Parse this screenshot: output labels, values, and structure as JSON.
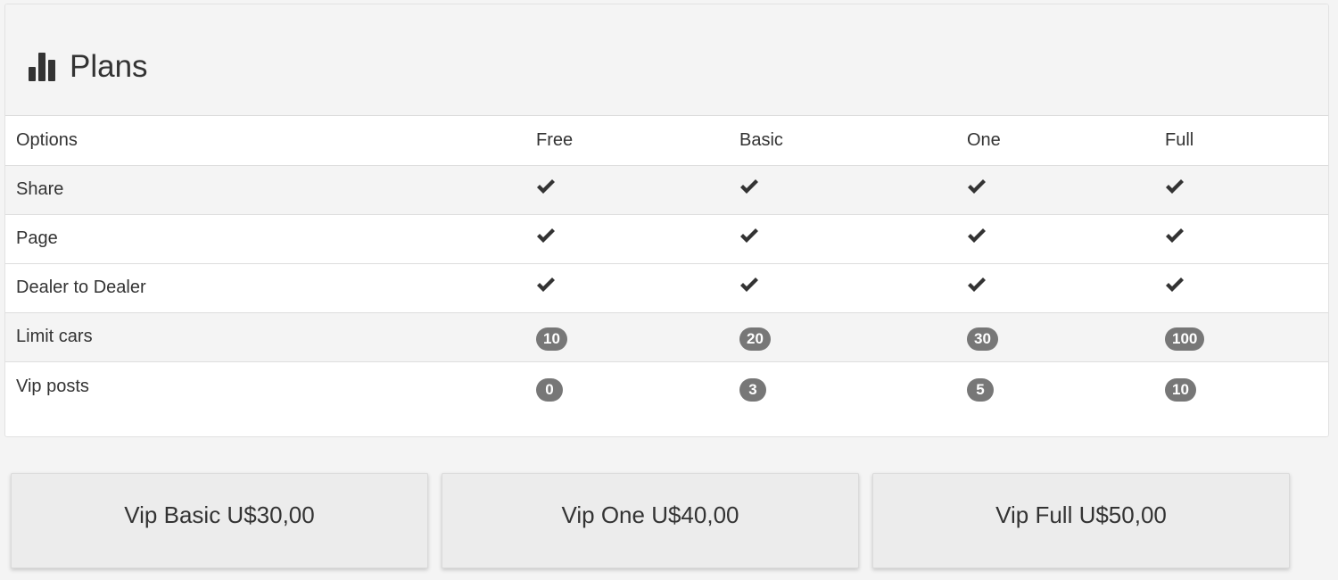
{
  "panel": {
    "title": "Plans",
    "icon": "bar-chart-icon"
  },
  "table": {
    "headers": [
      "Options",
      "Free",
      "Basic",
      "One",
      "Full"
    ],
    "rows": [
      {
        "label": "Share",
        "values": [
          "check",
          "check",
          "check",
          "check"
        ]
      },
      {
        "label": "Page",
        "values": [
          "check",
          "check",
          "check",
          "check"
        ]
      },
      {
        "label": "Dealer to Dealer",
        "values": [
          "check",
          "check",
          "check",
          "check"
        ]
      },
      {
        "label": "Limit cars",
        "values": [
          "10",
          "20",
          "30",
          "100"
        ]
      },
      {
        "label": "Vip posts",
        "values": [
          "0",
          "3",
          "5",
          "10"
        ]
      }
    ]
  },
  "buttons": [
    {
      "label": "Vip Basic U$30,00"
    },
    {
      "label": "Vip One U$40,00"
    },
    {
      "label": "Vip Full U$50,00"
    }
  ],
  "colors": {
    "badge": "#777777",
    "background": "#f4f4f4",
    "button": "#ececec"
  }
}
